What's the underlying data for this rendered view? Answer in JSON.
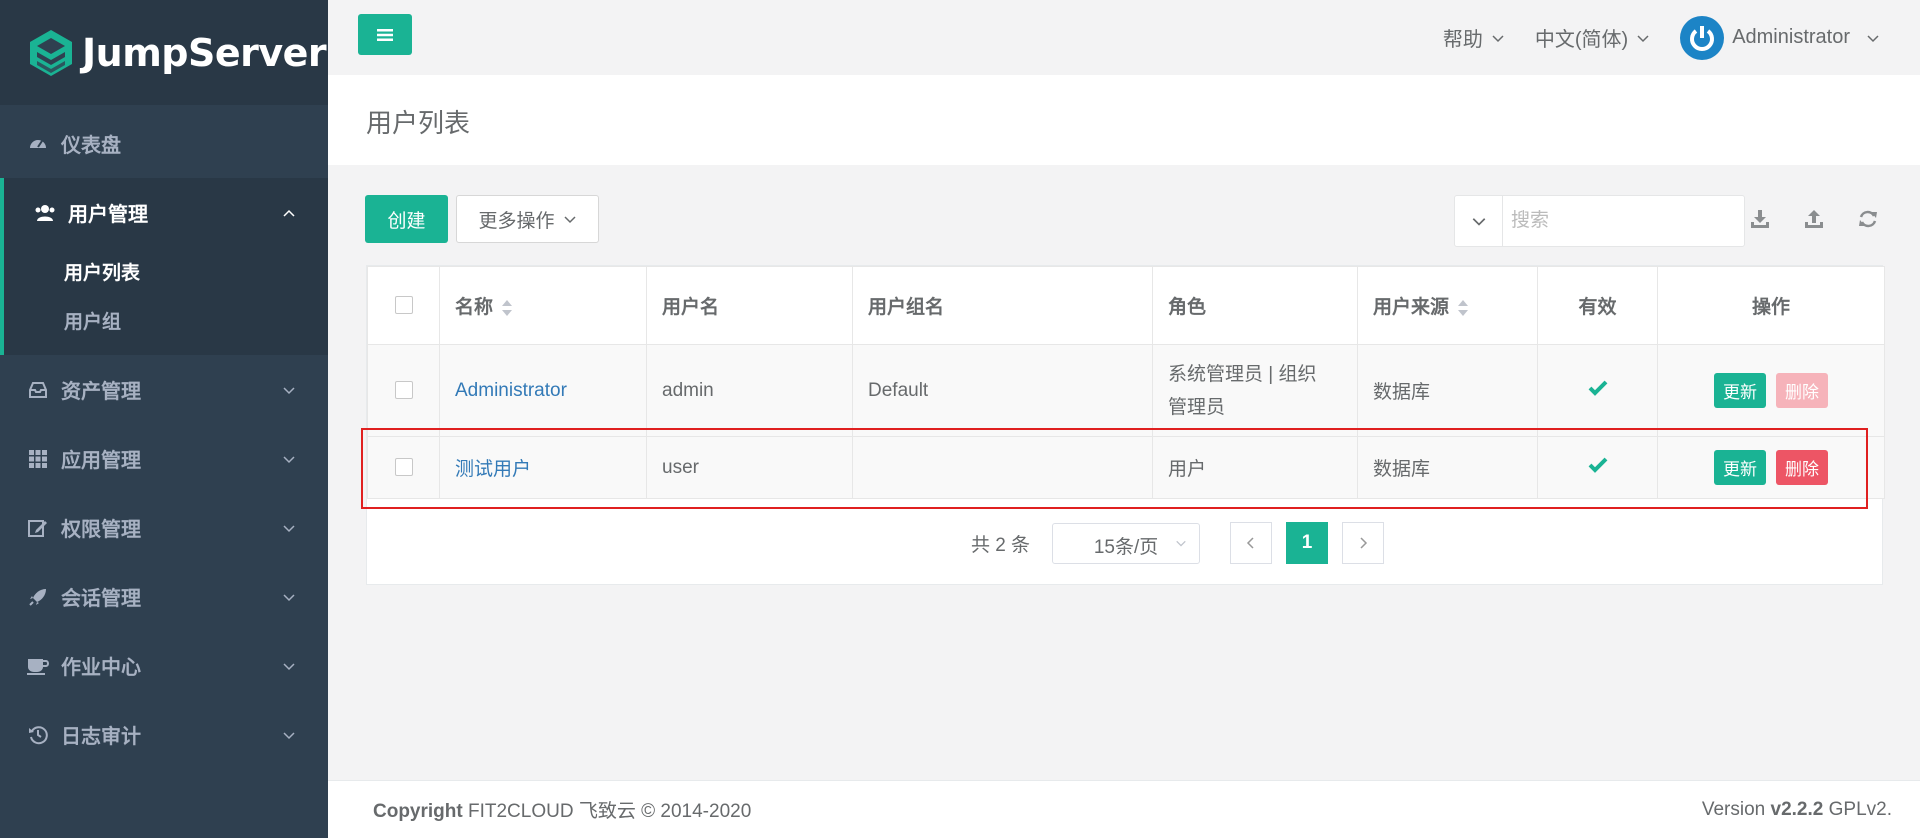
{
  "brand": {
    "name": "JumpServer"
  },
  "sidebar": {
    "dashboard": "仪表盘",
    "user_mgmt": {
      "label": "用户管理",
      "items": [
        "用户列表",
        "用户组"
      ]
    },
    "items": [
      "资产管理",
      "应用管理",
      "权限管理",
      "会话管理",
      "作业中心",
      "日志审计"
    ]
  },
  "topbar": {
    "help": "帮助",
    "language": "中文(简体)",
    "user": "Administrator"
  },
  "page": {
    "title": "用户列表"
  },
  "toolbar": {
    "create": "创建",
    "more": "更多操作",
    "search_placeholder": "搜索"
  },
  "table": {
    "headers": [
      "名称",
      "用户名",
      "用户组名",
      "角色",
      "用户来源",
      "有效",
      "操作"
    ],
    "rows": [
      {
        "name": "Administrator",
        "username": "admin",
        "group": "Default",
        "role_line1": "系统管理员 | 组织",
        "role_line2": "管理员",
        "source": "数据库",
        "update": "更新",
        "delete": "删除"
      },
      {
        "name": "测试用户",
        "username": "user",
        "group": "",
        "role_line1": "用户",
        "role_line2": "",
        "source": "数据库",
        "update": "更新",
        "delete": "删除"
      }
    ]
  },
  "pagination": {
    "total": "共 2 条",
    "page_size": "15条/页",
    "current": "1"
  },
  "footer": {
    "copyright_label": "Copyright",
    "copyright_text": "FIT2CLOUD 飞致云 © 2014-2020",
    "version_label": "Version",
    "version": "v2.2.2",
    "license": "GPLv2."
  },
  "colors": {
    "accent": "#1ab394",
    "sidebar": "#2f4050",
    "danger": "#ed5565",
    "link": "#337ab7"
  }
}
